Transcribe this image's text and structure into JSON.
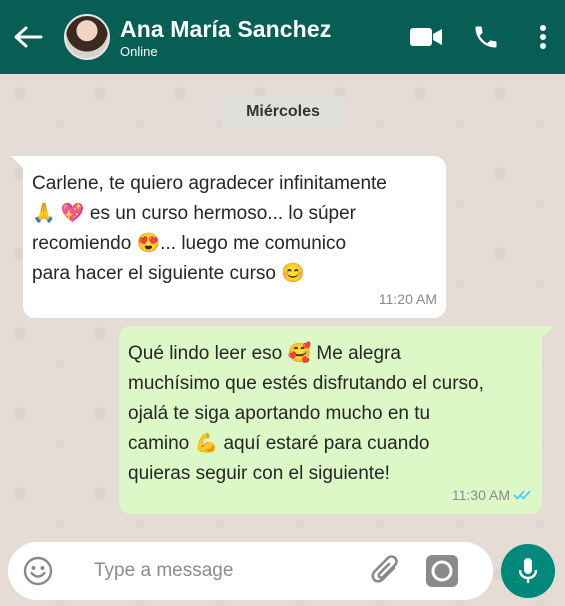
{
  "header": {
    "contact_name": "Ana María Sanchez",
    "status": "Online",
    "icons": [
      "back-arrow-icon",
      "video-call-icon",
      "phone-call-icon",
      "more-vert-icon"
    ]
  },
  "chat": {
    "day_label": "Miércoles",
    "messages": [
      {
        "direction": "incoming",
        "lines": [
          "Carlene, te quiero agradecer infinitamente",
          "🙏 💖 es un curso hermoso... lo súper",
          "recomiendo 😍... luego me comunico",
          "para hacer el siguiente curso 😊"
        ],
        "time": "11:20 AM"
      },
      {
        "direction": "outgoing",
        "lines": [
          "Qué lindo leer eso 🥰 Me alegra",
          "muchísimo que estés disfrutando el curso,",
          "ojalá te siga aportando mucho en tu",
          "camino 💪 aquí estaré para cuando",
          "quieras seguir con el siguiente!"
        ],
        "time": "11:30 AM",
        "read": true
      }
    ]
  },
  "composer": {
    "placeholder": "Type a message",
    "value": "",
    "icons": [
      "emoji-icon",
      "attach-icon",
      "camera-icon",
      "mic-icon"
    ]
  },
  "colors": {
    "header": "#075e54",
    "incoming_bubble": "#ffffff",
    "outgoing_bubble": "#dcf8c6",
    "mic_button": "#00897b",
    "read_ticks": "#4fc3f7"
  }
}
